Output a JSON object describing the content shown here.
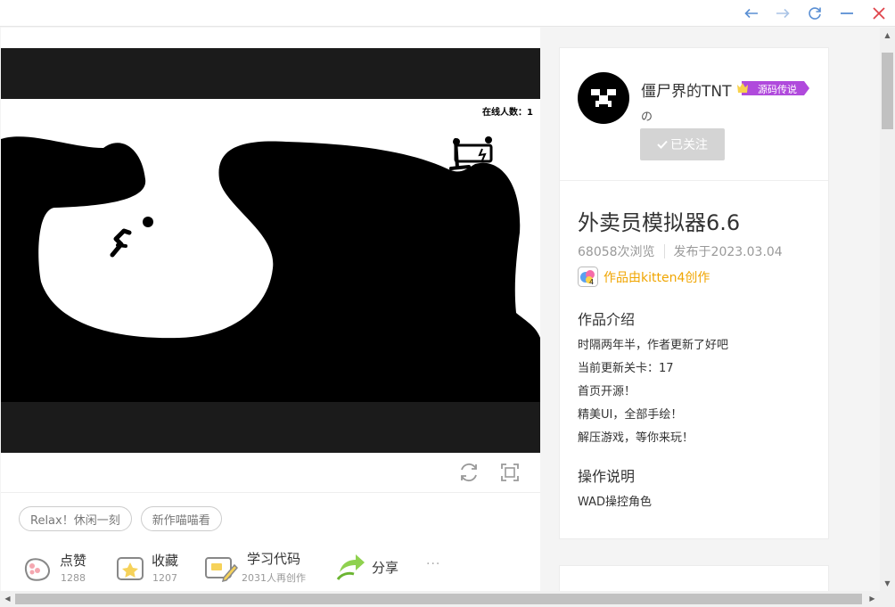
{
  "window": {
    "controls": [
      "back-icon",
      "forward-icon",
      "refresh-icon",
      "minimize-icon",
      "close-icon"
    ]
  },
  "game": {
    "online_count": "在线人数：1"
  },
  "tags": [
    "Relax！休闲一刻",
    "新作喵喵看"
  ],
  "actions": {
    "like": {
      "label": "点赞",
      "count": "1288"
    },
    "favorite": {
      "label": "收藏",
      "count": "1207"
    },
    "learn": {
      "label": "学习代码",
      "count": "2031人再创作"
    },
    "share": {
      "label": "分享"
    },
    "more": "···"
  },
  "author": {
    "name": "僵尸界的TNT",
    "name_suffix": "の",
    "badge": "源码传说",
    "follow_label": "已关注"
  },
  "work": {
    "title": "外卖员模拟器6.6",
    "views": "68058次浏览",
    "published": "发布于2023.03.04",
    "creator": "作品由kitten4创作"
  },
  "intro": {
    "title": "作品介绍",
    "lines": [
      "时隔两年半，作者更新了好吧",
      "当前更新关卡：17",
      "首页开源！",
      "精美UI，全部手绘！",
      "解压游戏，等你来玩！"
    ]
  },
  "instructions": {
    "title": "操作说明",
    "text": "WAD操控角色"
  },
  "colors": {
    "accent_creator": "#f0a500",
    "badge": "#b04adc",
    "follow_button": "#d4d4d4",
    "close": "#e0444b"
  }
}
